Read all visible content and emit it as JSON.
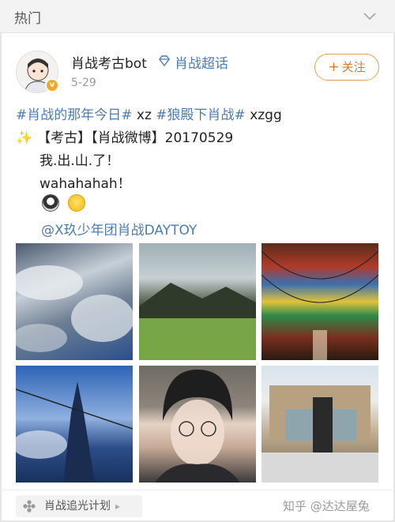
{
  "topbar": {
    "title": "热门",
    "collapse_icon": "chevron-down-icon"
  },
  "post": {
    "author": "肖战考古bot",
    "super_topic": "肖战超话",
    "time": "5-29",
    "follow_label": "关注",
    "follow_plus": "+",
    "verified_badge": "v",
    "text": {
      "tag1": "#肖战的那年今日#",
      "mid1": " xz ",
      "tag2": "#狼殿下肖战#",
      "mid2": "  xzgg",
      "line2": "【考古】【肖战微博】20170529",
      "line3": "我.出.山.了！",
      "line4": "wahahahah！",
      "mention": "@X玖少年团肖战DAYTOY"
    },
    "photos": [
      "sky-clouds",
      "mountain-meadow",
      "prayer-flags",
      "stupa-sky",
      "selfie-glasses",
      "building-person"
    ]
  },
  "footer": {
    "super_topic_label": "肖战追光计划",
    "watermark": "知乎 @达达屋兔"
  },
  "colors": {
    "link": "#4a7cb5",
    "follow": "#e07b24",
    "muted": "#999999"
  }
}
